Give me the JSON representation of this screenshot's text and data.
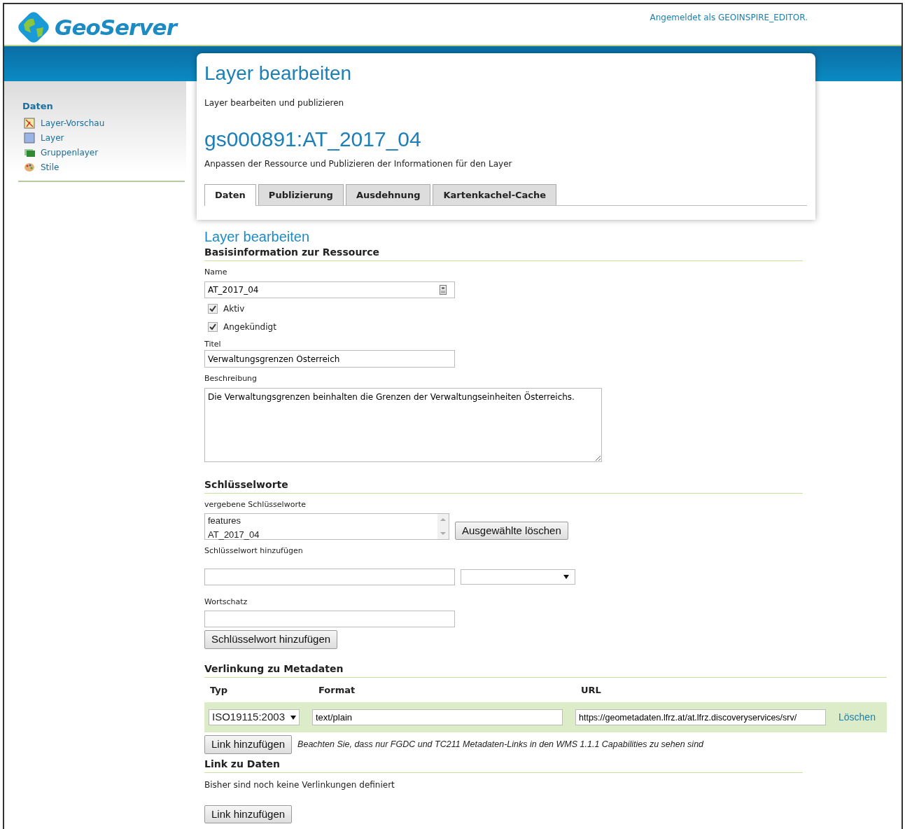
{
  "header": {
    "logo": "GeoServer",
    "login": "Angemeldet als GEOINSPIRE_EDITOR."
  },
  "sidebar": {
    "heading": "Daten",
    "items": [
      {
        "label": "Layer-Vorschau",
        "kind": "preview"
      },
      {
        "label": "Layer",
        "kind": "layer"
      },
      {
        "label": "Gruppenlayer",
        "kind": "group"
      },
      {
        "label": "Stile",
        "kind": "style"
      }
    ]
  },
  "page": {
    "title": "Layer bearbeiten",
    "subtitle": "Layer bearbeiten und publizieren",
    "layer_name": "gs000891:AT_2017_04",
    "description": "Anpassen der Ressource und Publizieren der Informationen für den Layer"
  },
  "tabs": [
    {
      "label": "Daten",
      "selected": true
    },
    {
      "label": "Publizierung",
      "selected": false
    },
    {
      "label": "Ausdehnung",
      "selected": false
    },
    {
      "label": "Kartenkachel-Cache",
      "selected": false
    }
  ],
  "basic": {
    "title": "Layer bearbeiten",
    "heading": "Basisinformation zur Ressource",
    "name_label": "Name",
    "name_value": "AT_2017_04",
    "checkboxes": [
      {
        "label": "Aktiv",
        "checked": true
      },
      {
        "label": "Angekündigt",
        "checked": true
      }
    ],
    "title_label": "Titel",
    "title_value": "Verwaltungsgrenzen Österreich",
    "description_label": "Beschreibung",
    "description_value": "Die Verwaltungsgrenzen beinhalten die Grenzen der Verwaltungseinheiten Österreichs."
  },
  "keywords": {
    "heading": "Schlüsselworte",
    "list_label": "vergebene Schlüsselworte",
    "items": [
      "features",
      "AT_2017_04"
    ],
    "delete_button": "Ausgewählte löschen",
    "add_label": "Schlüsselwort hinzufügen",
    "vocabulary_label": "Wortschatz",
    "add_button": "Schlüsselwort hinzufügen"
  },
  "metadata_links": {
    "heading": "Verlinkung zu Metadaten",
    "columns": [
      "Typ",
      "Format",
      "URL"
    ],
    "rows": [
      {
        "type": "ISO19115:2003",
        "format": "text/plain",
        "url": "https://geometadaten.lfrz.at/at.lfrz.discoveryservices/srv/",
        "action": "Löschen"
      }
    ],
    "add_button": "Link hinzufügen",
    "note": "Beachten Sie, dass nur FGDC und TC211 Metadaten-Links in den WMS 1.1.1 Capabilities zu sehen sind"
  },
  "data_links": {
    "heading": "Link zu Daten",
    "empty_text": "Bisher sind noch keine Verlinkungen definiert",
    "add_button": "Link hinzufügen"
  }
}
